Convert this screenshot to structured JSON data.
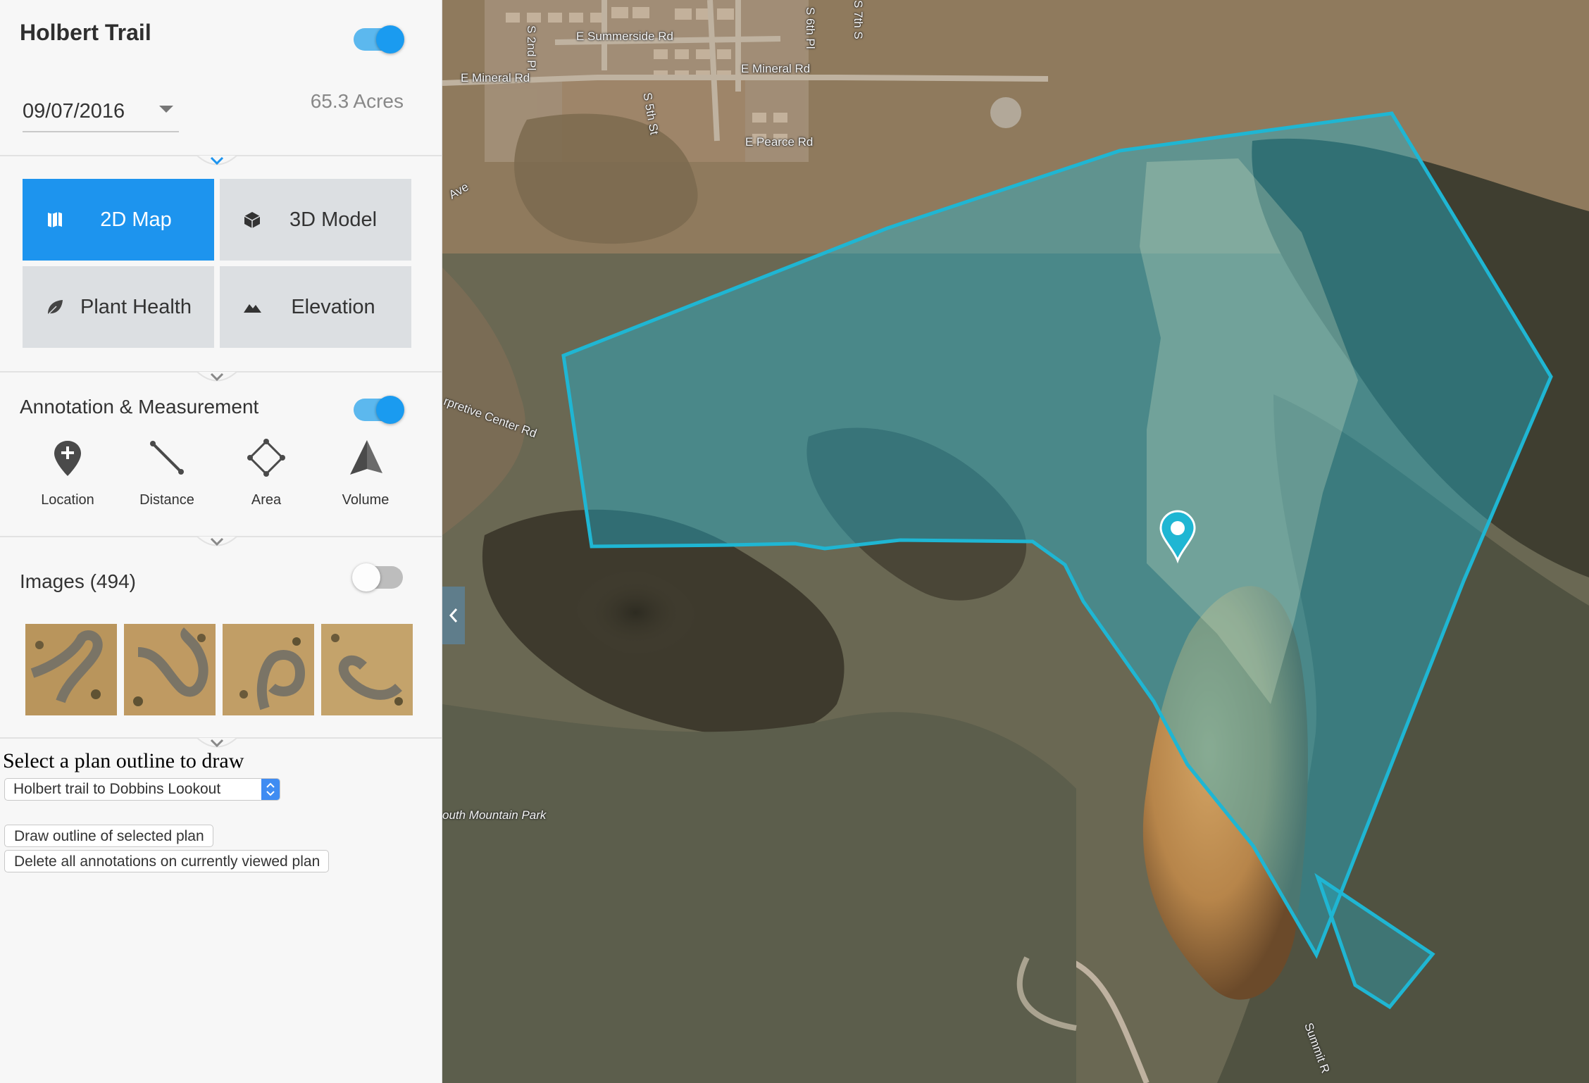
{
  "project": {
    "title": "Holbert Trail"
  },
  "date_select": {
    "value": "09/07/2016"
  },
  "area": {
    "acres": "65.3 Acres"
  },
  "views": [
    {
      "label": "2D Map",
      "icon": "map-icon",
      "active": true
    },
    {
      "label": "3D Model",
      "icon": "cube-icon",
      "active": false
    },
    {
      "label": "Plant Health",
      "icon": "leaf-icon",
      "active": false
    },
    {
      "label": "Elevation",
      "icon": "mountain-icon",
      "active": false
    }
  ],
  "annotation": {
    "title": "Annotation & Measurement",
    "enabled": true,
    "tools": [
      {
        "label": "Location",
        "icon": "location-pin-add-icon"
      },
      {
        "label": "Distance",
        "icon": "distance-line-icon"
      },
      {
        "label": "Area",
        "icon": "area-polygon-icon"
      },
      {
        "label": "Volume",
        "icon": "volume-pyramid-icon"
      }
    ]
  },
  "images": {
    "title": "Images (494)",
    "enabled": false
  },
  "plan": {
    "prompt": "Select a plan outline to draw",
    "selected": "Holbert trail to Dobbins Lookout",
    "draw_button": "Draw outline of selected plan",
    "delete_button": "Delete all annotations on currently viewed plan"
  },
  "map": {
    "labels": {
      "summerside": "E Summerside Rd",
      "mineral_w": "E Mineral Rd",
      "mineral_e": "E Mineral Rd",
      "pearce": "E Pearce Rd",
      "s2nd": "S 2nd Pl",
      "s6th": "S 6th Pl",
      "s5th": "S 5th St",
      "s7th": "S 7th S",
      "ave": "Ave",
      "interpretive": "rpretive Center Rd",
      "park": "outh Mountain Park",
      "summit": "Summit R"
    },
    "outline_color": "#1fb6d3"
  }
}
